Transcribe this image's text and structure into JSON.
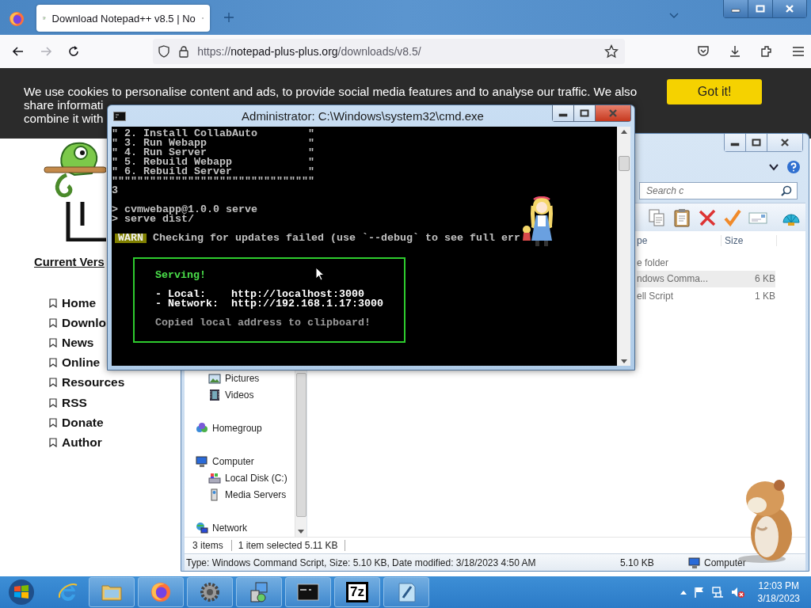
{
  "browser": {
    "tab": {
      "title": "Download Notepad++ v8.5 | No",
      "selected": true
    },
    "nav_buttons": [
      {
        "kind": "back",
        "disabled": false
      },
      {
        "kind": "forward",
        "disabled": true
      },
      {
        "kind": "reload",
        "disabled": false
      }
    ],
    "url": {
      "scheme": "https://",
      "host": "notepad-plus-plus.org",
      "path": "/downloads/v8.5/"
    },
    "cookie_banner": {
      "lines": [
        "We use cookies to personalise content and ads, to provide social media features and to analyse our traffic. We also",
        "share informati",
        "combine it with"
      ],
      "button": "Got it!"
    },
    "sidebar": {
      "heading": "Current Vers",
      "links": [
        "Home",
        "Downlo",
        "News",
        "Online",
        "Resources",
        "RSS",
        "Donate",
        "Author"
      ]
    }
  },
  "cmd_window": {
    "title": "Administrator:  C:\\Windows\\system32\\cmd.exe",
    "menu_lines": [
      "\" 2. Install CollabAuto        \"",
      "\" 3. Run Webapp                \"",
      "\" 4. Run Server                \"",
      "\" 5. Rebuild Webapp            \"",
      "\" 6. Rebuild Server            \"",
      "\"\"\"\"\"\"\"\"\"\"\"\"\"\"\"\"\"\"\"\"\"\"\"\"\"\"\"\"\"\"\"\""
    ],
    "choice": "3",
    "command_lines": [
      "> cvmwebapp@1.0.0 serve",
      "> serve dist/"
    ],
    "warning": {
      "badge": "WARN",
      "text": "Checking for updates failed (use `--debug` to see full err"
    },
    "serve_box": {
      "title": "Serving!",
      "rows": [
        "- Local:    http://localhost:3000",
        "- Network:  http://192.168.1.17:3000"
      ],
      "note": "Copied local address to clipboard!"
    }
  },
  "explorer": {
    "search": {
      "placeholder": "Search c"
    },
    "columns": [
      "pe",
      "Size"
    ],
    "rows": [
      {
        "column_1": "e folder",
        "selected": false
      },
      {
        "column_1": "ndows Comma...",
        "size": "6 KB",
        "selected": true
      },
      {
        "column_1": "ell Script",
        "size": "1 KB",
        "selected": false
      }
    ],
    "nav_tree": [
      {
        "children": [
          {
            "label": "Pictures",
            "kind": "pictures"
          },
          {
            "label": "Videos",
            "kind": "videos"
          }
        ]
      },
      {
        "label": "Homegroup",
        "kind": "homegroup"
      },
      {
        "label": "Computer",
        "kind": "computer",
        "children": [
          {
            "label": "Local Disk (C:)",
            "kind": "disk"
          },
          {
            "label": "Media Servers",
            "kind": "media"
          }
        ]
      },
      {
        "label": "Network",
        "kind": "network"
      }
    ],
    "status": {
      "items": "3 items",
      "selection": "1 item selected  5.11 KB"
    },
    "details": {
      "description": "Type: Windows Command Script, Size: 5.10 KB, Date modified: 3/18/2023 4:50 AM",
      "size": "5.10 KB",
      "location": "Computer"
    }
  },
  "taskbar": {
    "items": [
      {
        "kind": "ie",
        "running": false
      },
      {
        "kind": "folder",
        "running": true
      },
      {
        "kind": "firefox",
        "running": true
      },
      {
        "kind": "gear",
        "running": true
      },
      {
        "kind": "setup",
        "running": true
      },
      {
        "kind": "cmd",
        "running": true
      },
      {
        "kind": "sevenzip",
        "running": true,
        "label": "7z"
      },
      {
        "kind": "notepad",
        "running": true
      }
    ],
    "clock": {
      "time": "12:03 PM",
      "date": "3/18/2023"
    }
  }
}
